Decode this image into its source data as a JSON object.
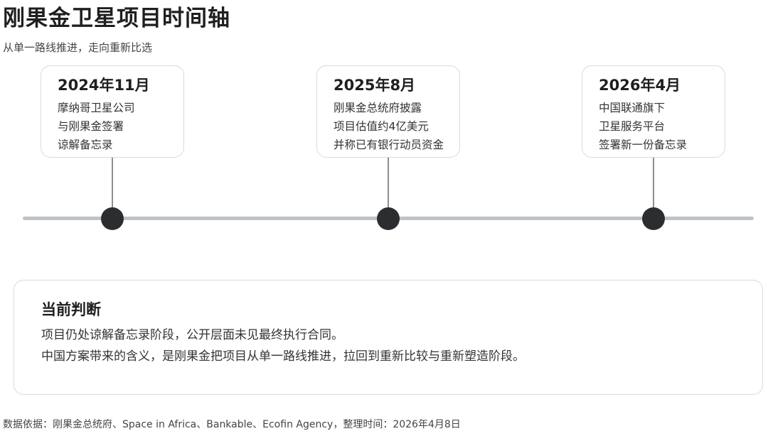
{
  "header": {
    "title": "刚果金卫星项目时间轴",
    "subtitle": "从单一路线推进，走向重新比选"
  },
  "timeline": [
    {
      "date": "2024年11月",
      "lines": [
        "摩纳哥卫星公司",
        "与刚果金签署",
        "谅解备忘录"
      ]
    },
    {
      "date": "2025年8月",
      "lines": [
        "刚果金总统府披露",
        "项目估值约4亿美元",
        "并称已有银行动员资金"
      ]
    },
    {
      "date": "2026年4月",
      "lines": [
        "中国联通旗下",
        "卫星服务平台",
        "签署新一份备忘录"
      ]
    }
  ],
  "judgement": {
    "title": "当前判断",
    "lines": [
      "项目仍处谅解备忘录阶段，公开层面未见最终执行合同。",
      "中国方案带来的含义，是刚果金把项目从单一路线推进，拉回到重新比较与重新塑造阶段。"
    ]
  },
  "footer": {
    "source": "数据依据：刚果金总统府、Space in Africa、Bankable、Ecofin Agency，整理时间：2026年4月8日"
  },
  "colors": {
    "dot": "#2b2d30",
    "line": "#bcc3c9",
    "card_border": "#d6dbe0"
  }
}
